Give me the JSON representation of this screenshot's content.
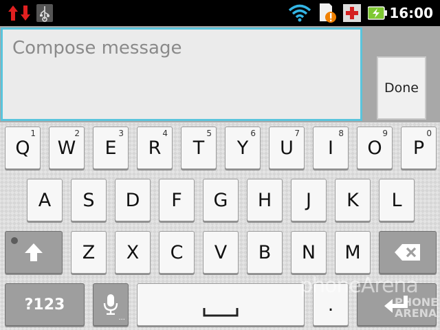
{
  "status_bar": {
    "time": "16:00",
    "icons": [
      "data-transfer-icon",
      "usb-icon",
      "wifi-icon",
      "sd-card-warning-icon",
      "medical-cross-icon",
      "battery-charging-icon"
    ],
    "colors": {
      "data": "#e02020",
      "wifi": "#33b5e5",
      "battery": "#7ec832",
      "cross": "#d42020"
    }
  },
  "compose": {
    "placeholder": "Compose message",
    "done_label": "Done",
    "accent": "#5ac4dc"
  },
  "keyboard": {
    "row1": [
      {
        "label": "Q",
        "hint": "1"
      },
      {
        "label": "W",
        "hint": "2"
      },
      {
        "label": "E",
        "hint": "3"
      },
      {
        "label": "R",
        "hint": "4"
      },
      {
        "label": "T",
        "hint": "5"
      },
      {
        "label": "Y",
        "hint": "6"
      },
      {
        "label": "U",
        "hint": "7"
      },
      {
        "label": "I",
        "hint": "8"
      },
      {
        "label": "O",
        "hint": "9"
      },
      {
        "label": "P",
        "hint": "0"
      }
    ],
    "row2": [
      "A",
      "S",
      "D",
      "F",
      "G",
      "H",
      "J",
      "K",
      "L"
    ],
    "row3": [
      "Z",
      "X",
      "C",
      "V",
      "B",
      "N",
      "M"
    ],
    "symbols_label": "?123",
    "period_label": ".",
    "icons": [
      "shift-icon",
      "backspace-icon",
      "microphone-icon",
      "space-bar-icon",
      "enter-icon"
    ]
  },
  "watermark": {
    "line1": "phoneArena",
    "line2": "PHONE",
    "line3": "ARENA"
  }
}
